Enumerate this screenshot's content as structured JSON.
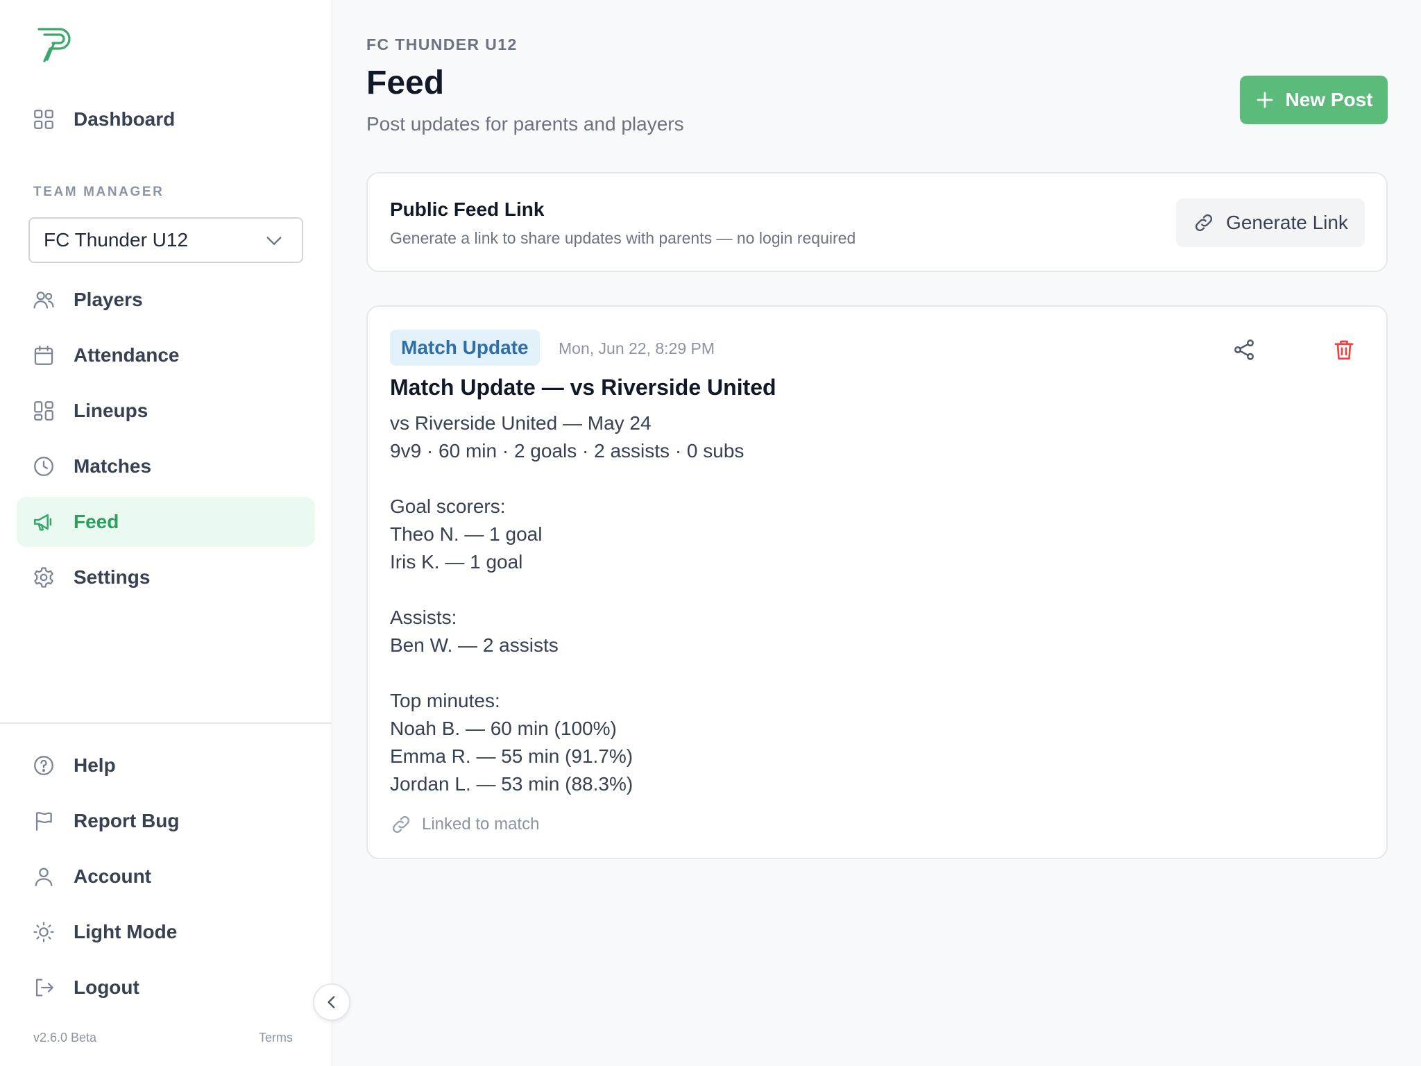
{
  "sidebar": {
    "logo_icon": "brand-p-logo",
    "nav_top": [
      {
        "label": "Dashboard",
        "icon": "grid-icon"
      }
    ],
    "section_label": "TEAM MANAGER",
    "team_select": {
      "value": "FC Thunder U12"
    },
    "nav_team": [
      {
        "label": "Players",
        "icon": "users-icon"
      },
      {
        "label": "Attendance",
        "icon": "calendar-icon"
      },
      {
        "label": "Lineups",
        "icon": "layout-icon"
      },
      {
        "label": "Matches",
        "icon": "clock-icon"
      },
      {
        "label": "Feed",
        "icon": "megaphone-icon",
        "active": true
      },
      {
        "label": "Settings",
        "icon": "gear-icon"
      }
    ],
    "nav_bottom": [
      {
        "label": "Help",
        "icon": "help-icon"
      },
      {
        "label": "Report Bug",
        "icon": "flag-icon"
      },
      {
        "label": "Account",
        "icon": "user-icon"
      },
      {
        "label": "Light Mode",
        "icon": "sun-icon"
      },
      {
        "label": "Logout",
        "icon": "logout-icon"
      }
    ],
    "version": "v2.6.0 Beta",
    "terms": "Terms"
  },
  "header": {
    "eyebrow": "FC THUNDER U12",
    "title": "Feed",
    "subtitle": "Post updates for parents and players",
    "new_post_label": "New Post"
  },
  "public_link": {
    "title": "Public Feed Link",
    "description": "Generate a link to share updates with parents — no login required",
    "button_label": "Generate Link"
  },
  "post": {
    "badge": "Match Update",
    "date": "Mon, Jun 22, 8:29 PM",
    "title": "Match Update — vs Riverside United",
    "body_lines": [
      "vs Riverside United — May 24",
      "9v9 · 60 min · 2 goals · 2 assists · 0 subs",
      "",
      "Goal scorers:",
      "Theo N. — 1 goal",
      "Iris K. — 1 goal",
      "",
      "Assists:",
      "Ben W. — 2 assists",
      "",
      "Top minutes:",
      "Noah B. — 60 min (100%)",
      "Emma R. — 55 min (91.7%)",
      "Jordan L. — 53 min (88.3%)"
    ],
    "linked_label": "Linked to match"
  },
  "colors": {
    "accent": "#5abb7b",
    "active_bg": "#eafaf1",
    "badge_bg": "#e3f1fb",
    "badge_text": "#2d6fa6",
    "danger": "#ef4444"
  }
}
